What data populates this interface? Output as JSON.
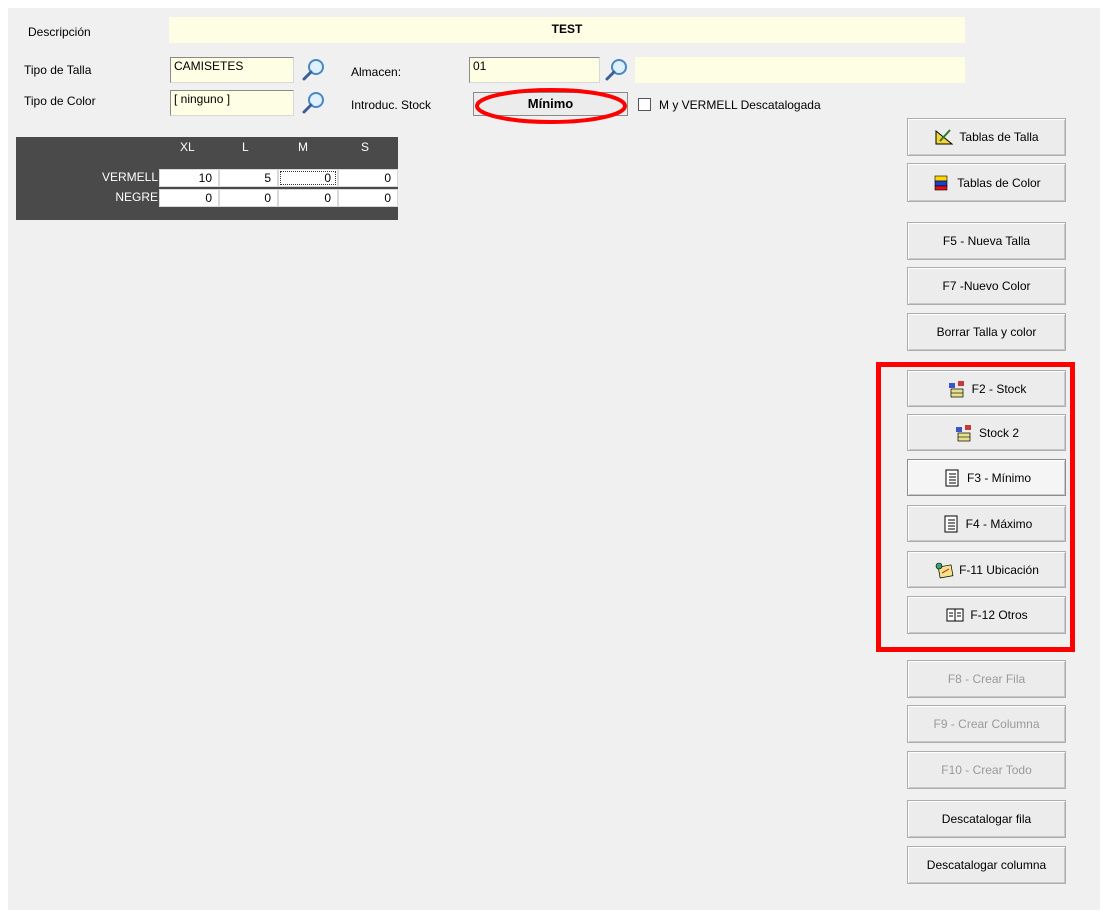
{
  "form": {
    "descripcion_label": "Descripción",
    "descripcion_value": "TEST",
    "tipo_talla_label": "Tipo de Talla",
    "tipo_talla_value": "CAMISETES",
    "tipo_color_label": "Tipo de Color",
    "tipo_color_value": "[ ninguno ]",
    "almacen_label": "Almacen:",
    "almacen_value": "01",
    "almacen_desc_value": "",
    "introduc_label": "Introduc. Stock",
    "introduc_value": "Mínimo",
    "checkbox_label": "M y VERMELL Descatalogada",
    "checkbox_checked": false
  },
  "grid": {
    "columns": [
      "XL",
      "L",
      "M",
      "S"
    ],
    "rows": [
      {
        "label": "VERMELL",
        "values": [
          "10",
          "5",
          "0",
          "0"
        ]
      },
      {
        "label": "NEGRE",
        "values": [
          "0",
          "0",
          "0",
          "0"
        ]
      }
    ]
  },
  "buttons": {
    "tablas_talla": "Tablas de Talla",
    "tablas_color": "Tablas de Color",
    "nueva_talla": "F5 - Nueva Talla",
    "nuevo_color": "F7 -Nuevo Color",
    "borrar": "Borrar Talla y color",
    "stock": "F2 - Stock",
    "stock2": "Stock 2",
    "minimo": "F3 - Mínimo",
    "maximo": "F4 - Máximo",
    "ubicacion": "F-11 Ubicación",
    "otros": "F-12 Otros",
    "crear_fila": "F8 - Crear Fila",
    "crear_columna": "F9 - Crear Columna",
    "crear_todo": "F10 - Crear Todo",
    "descat_fila": "Descatalogar fila",
    "descat_columna": "Descatalogar columna"
  },
  "colors": {
    "field_yellow": "#fefee4",
    "grid_header": "#4a4a4a",
    "annotation_red": "#ff0000"
  },
  "icons": {
    "lookup": "magnifier-icon",
    "tablas_talla": "ruler-icon",
    "tablas_color": "color-flag-icon",
    "stock": "boxes-icon",
    "minimo": "document-list-icon",
    "ubicacion": "location-icon",
    "otros": "book-icon"
  }
}
